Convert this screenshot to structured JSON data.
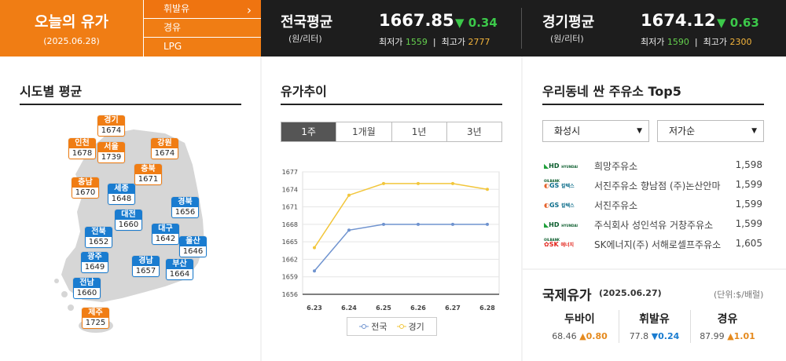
{
  "header": {
    "title": "오늘의 유가",
    "date": "(2025.06.28)",
    "fuel_types": [
      "휘발유",
      "경유",
      "LPG"
    ],
    "national": {
      "label": "전국평균",
      "unit": "(원/리터)",
      "price": "1667.85",
      "change": "▼ 0.34",
      "min_label": "최저가",
      "min": "1559",
      "max_label": "최고가",
      "max": "2777"
    },
    "gyeonggi": {
      "label": "경기평균",
      "unit": "(원/리터)",
      "price": "1674.12",
      "change": "▼ 0.63",
      "min_label": "최저가",
      "min": "1590",
      "max_label": "최고가",
      "max": "2300"
    }
  },
  "regional": {
    "title": "시도별 평균",
    "regions": [
      {
        "name": "경기",
        "value": "1674",
        "color": "orange"
      },
      {
        "name": "인천",
        "value": "1678",
        "color": "orange"
      },
      {
        "name": "서울",
        "value": "1739",
        "color": "orange"
      },
      {
        "name": "강원",
        "value": "1674",
        "color": "orange"
      },
      {
        "name": "충북",
        "value": "1671",
        "color": "orange"
      },
      {
        "name": "충남",
        "value": "1670",
        "color": "orange"
      },
      {
        "name": "세종",
        "value": "1648",
        "color": "blue"
      },
      {
        "name": "경북",
        "value": "1656",
        "color": "blue"
      },
      {
        "name": "대전",
        "value": "1660",
        "color": "blue"
      },
      {
        "name": "전북",
        "value": "1652",
        "color": "blue"
      },
      {
        "name": "대구",
        "value": "1642",
        "color": "blue"
      },
      {
        "name": "울산",
        "value": "1646",
        "color": "blue"
      },
      {
        "name": "광주",
        "value": "1649",
        "color": "blue"
      },
      {
        "name": "경남",
        "value": "1657",
        "color": "blue"
      },
      {
        "name": "부산",
        "value": "1664",
        "color": "blue"
      },
      {
        "name": "전남",
        "value": "1660",
        "color": "blue"
      },
      {
        "name": "제주",
        "value": "1725",
        "color": "orange"
      }
    ]
  },
  "trend": {
    "title": "유가추이",
    "tabs": [
      "1주",
      "1개월",
      "1년",
      "3년"
    ],
    "active_tab": "1주"
  },
  "chart_data": {
    "type": "line",
    "x": [
      "6.23",
      "6.24",
      "6.25",
      "6.26",
      "6.27",
      "6.28"
    ],
    "y_ticks": [
      1677,
      1674,
      1671,
      1668,
      1665,
      1662,
      1659,
      1656
    ],
    "ylim": [
      1656,
      1677
    ],
    "series": [
      {
        "name": "전국",
        "values": [
          1660,
          1667,
          1668,
          1668,
          1668,
          1668
        ],
        "color": "#6f93cf"
      },
      {
        "name": "경기",
        "values": [
          1664,
          1673,
          1675,
          1675,
          1675,
          1674
        ],
        "color": "#f2c63b"
      }
    ]
  },
  "top5": {
    "title": "우리동네 싼 주유소 Top5",
    "region_select": "화성시",
    "sort_select": "저가순",
    "stations": [
      {
        "brand": "HD HYUNDAI OILBANK",
        "name": "희망주유소",
        "price": "1,598"
      },
      {
        "brand": "GS칼텍스",
        "name": "서진주유소 향남점 (주)논산안마",
        "price": "1,599"
      },
      {
        "brand": "GS칼텍스",
        "name": "서진주유소",
        "price": "1,599"
      },
      {
        "brand": "HD HYUNDAI OILBANK",
        "name": "주식회사 성인석유 거창주유소",
        "price": "1,599"
      },
      {
        "brand": "SK에너지",
        "name": "SK에너지(주) 서해로셀프주유소",
        "price": "1,605"
      }
    ]
  },
  "international": {
    "title": "국제유가",
    "date": "(2025.06.27)",
    "unit": "(단위:$/배럴)",
    "items": [
      {
        "name": "두바이",
        "price": "68.46",
        "change": "▲0.80"
      },
      {
        "name": "휘발유",
        "price": "77.8",
        "change": "▼0.24"
      },
      {
        "name": "경유",
        "price": "87.99",
        "change": "▲1.01"
      }
    ]
  }
}
